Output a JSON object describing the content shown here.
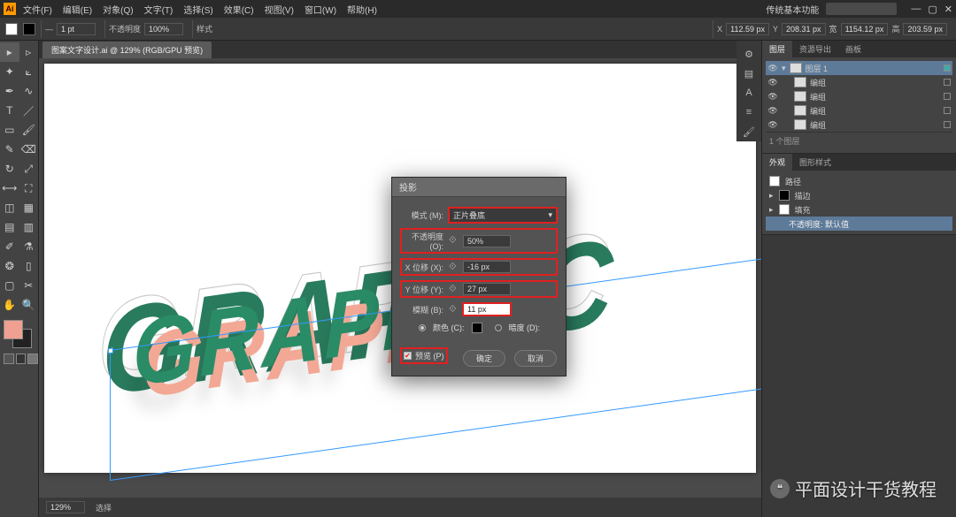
{
  "app": {
    "icon": "Ai"
  },
  "menus": [
    "文件(F)",
    "编辑(E)",
    "对象(Q)",
    "文字(T)",
    "选择(S)",
    "效果(C)",
    "视图(V)",
    "窗口(W)",
    "帮助(H)"
  ],
  "titlebar_right": "传统基本功能",
  "window_controls": [
    "—",
    "▢",
    "✕"
  ],
  "controlbar": {
    "stroke_unit": "1 pt",
    "opacity_label": "不透明度",
    "opacity": "100%",
    "style_label": "样式",
    "x_label": "X",
    "x": "112.59 px",
    "y_label": "Y",
    "y": "208.31 px",
    "w_label": "宽",
    "w": "1154.12 px",
    "h_label": "高",
    "h": "203.59 px"
  },
  "doc_tab": "图案文字设计.ai @ 129% (RGB/GPU 预览)",
  "canvas_text": "GRAPHIC",
  "dialog": {
    "title": "投影",
    "mode_label": "模式 (M):",
    "mode_value": "正片叠底",
    "opacity_label": "不透明度 (O):",
    "opacity_value": "50%",
    "xoffset_label": "X 位移 (X):",
    "xoffset_value": "-16 px",
    "yoffset_label": "Y 位移 (Y):",
    "yoffset_value": "27 px",
    "blur_label": "模糊 (B):",
    "blur_value": "11 px",
    "color_label": "颜色 (C):",
    "dark_label": "暗度 (D):",
    "preview_label": "预览 (P)",
    "ok": "确定",
    "cancel": "取消"
  },
  "layers": {
    "tabs": [
      "图层",
      "资源导出",
      "画板"
    ],
    "top": "图层 1",
    "items": [
      "编组",
      "编组",
      "编组",
      "编组"
    ],
    "footer": "1 个图层"
  },
  "right_panel_tabs": [
    "属性",
    "库",
    "画笔",
    "字符",
    "段落"
  ],
  "right_icons": [
    "库",
    "属性",
    "描边",
    "字符",
    "段落"
  ],
  "appearance": {
    "tabs": [
      "外观",
      "图形样式"
    ],
    "path_label": "路径",
    "stroke_label": "描边",
    "fill_label": "填充",
    "opacity_label": "不透明度: 默认值",
    "effect_row": "不透明度: 默认值"
  },
  "statusbar": {
    "zoom": "129%",
    "tool": "选择"
  },
  "watermark": "平面设计干货教程"
}
